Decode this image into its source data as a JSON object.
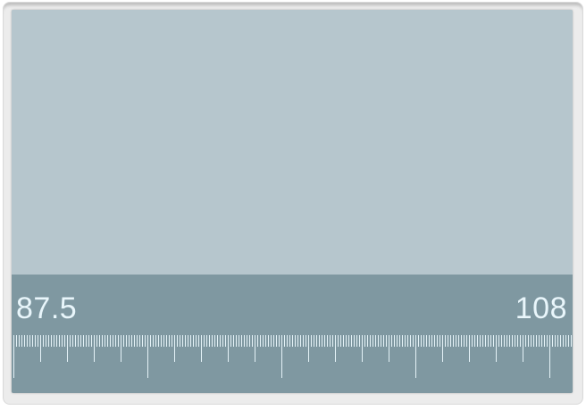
{
  "tuner": {
    "min_frequency": "87.5",
    "max_frequency": "108"
  },
  "colors": {
    "display_background": "#b6c6cd",
    "tuner_strip_background": "#7f98a1",
    "scale_ticks": "#e4f2f7",
    "label_text": "#e9f6fb"
  }
}
